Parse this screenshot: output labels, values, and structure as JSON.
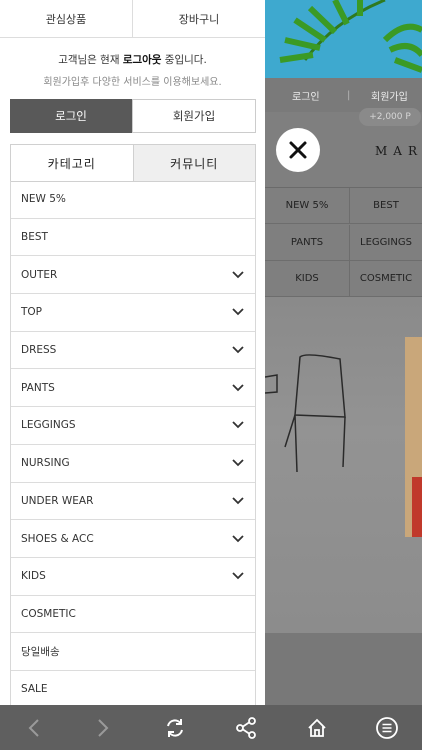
{
  "drawer": {
    "top_tabs": [
      "관심상품",
      "장바구니"
    ],
    "greeting": {
      "prefix": "고객님은 현재 ",
      "status": "로그아웃",
      "suffix": " 중입니다.",
      "sub": "회원가입후 다양한 서비스를 이용해보세요."
    },
    "auth": {
      "login": "로그인",
      "join": "회원가입"
    },
    "category_tabs": {
      "active": "카테고리",
      "inactive": "커뮤니티"
    },
    "menu": [
      {
        "label": "NEW 5%",
        "expandable": false
      },
      {
        "label": "BEST",
        "expandable": false
      },
      {
        "label": "OUTER",
        "expandable": true
      },
      {
        "label": "TOP",
        "expandable": true
      },
      {
        "label": "DRESS",
        "expandable": true
      },
      {
        "label": "PANTS",
        "expandable": true
      },
      {
        "label": "LEGGINGS",
        "expandable": true
      },
      {
        "label": "NURSING",
        "expandable": true
      },
      {
        "label": "UNDER WEAR",
        "expandable": true
      },
      {
        "label": "SHOES & ACC",
        "expandable": true
      },
      {
        "label": "KIDS",
        "expandable": true
      },
      {
        "label": "COSMETIC",
        "expandable": false
      },
      {
        "label": "당일배송",
        "expandable": false
      },
      {
        "label": "SALE",
        "expandable": false
      }
    ]
  },
  "background": {
    "topbar": {
      "login": "로그인",
      "join": "회원가입"
    },
    "points_badge": "+2,000 P",
    "logo": "MAR",
    "grid": [
      [
        "NEW 5%",
        "BEST"
      ],
      [
        "PANTS",
        "LEGGINGS"
      ],
      [
        "KIDS",
        "COSMETIC"
      ]
    ]
  },
  "bottombar": {
    "icons": [
      "back-icon",
      "forward-icon",
      "refresh-icon",
      "share-icon",
      "home-icon",
      "menu-icon"
    ]
  },
  "colors": {
    "login_bg": "#595959",
    "bar_bg": "#5f5f5f",
    "overlay": "#7f7f7f"
  }
}
